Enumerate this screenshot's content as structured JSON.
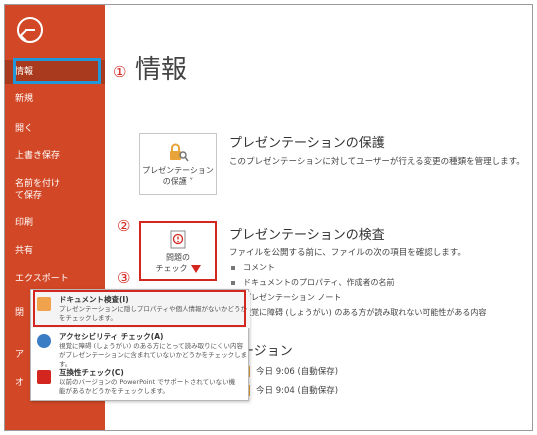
{
  "sidebar": {
    "items": [
      {
        "label": "情報",
        "active": true
      },
      {
        "label": "新規"
      },
      {
        "label": "開く"
      },
      {
        "label": "上書き保存"
      },
      {
        "label": "名前を付けて保存"
      },
      {
        "label": "印刷"
      },
      {
        "label": "共有"
      },
      {
        "label": "エクスポート"
      },
      {
        "label": "閉"
      },
      {
        "label": "ア"
      },
      {
        "label": "オ"
      }
    ]
  },
  "main": {
    "title": "情報",
    "markers": [
      "①",
      "②",
      "③"
    ],
    "protect": {
      "tile_label_1": "プレゼンテーション",
      "tile_label_2": "の保護 ˅",
      "heading": "プレゼンテーションの保護",
      "desc": "このプレゼンテーションに対してユーザーが行える変更の種類を管理します。"
    },
    "inspect": {
      "tile_label_1": "問題の",
      "tile_label_2": "チェック",
      "heading": "プレゼンテーションの検査",
      "desc": "ファイルを公開する前に、ファイルの次の項目を確認します。",
      "bullets": [
        "コメント",
        "ドキュメントのプロパティ、作成者の名前",
        "プレゼンテーション ノート",
        "視覚に障碍 (しょうがい) のある方が読み取れない可能性がある内容"
      ]
    },
    "versions": {
      "heading": "ージョン",
      "items": [
        "今日 9:06 (自動保存)",
        "今日 9:04 (自動保存)"
      ]
    }
  },
  "menu": {
    "items": [
      {
        "title": "ドキュメント検査(I)",
        "desc_1": "プレゼンテーションに隠しプロパティや個人情報がないかどうか",
        "desc_2": "をチェックします。"
      },
      {
        "title": "アクセシビリティ チェック(A)",
        "desc_1": "視覚に障碍 (しょうがい) のある方にとって読み取りにくい内容",
        "desc_2": "がプレゼンテーションに含まれていないかどうかをチェックします。"
      },
      {
        "title": "互換性チェック(C)",
        "desc_1": "以前のバージョンの PowerPoint でサポートされていない機",
        "desc_2": "能があるかどうかをチェックします。"
      }
    ]
  },
  "colors": {
    "accent": "#d24726",
    "highlight_box": "#d2261e",
    "active_outline": "#2196d8"
  }
}
